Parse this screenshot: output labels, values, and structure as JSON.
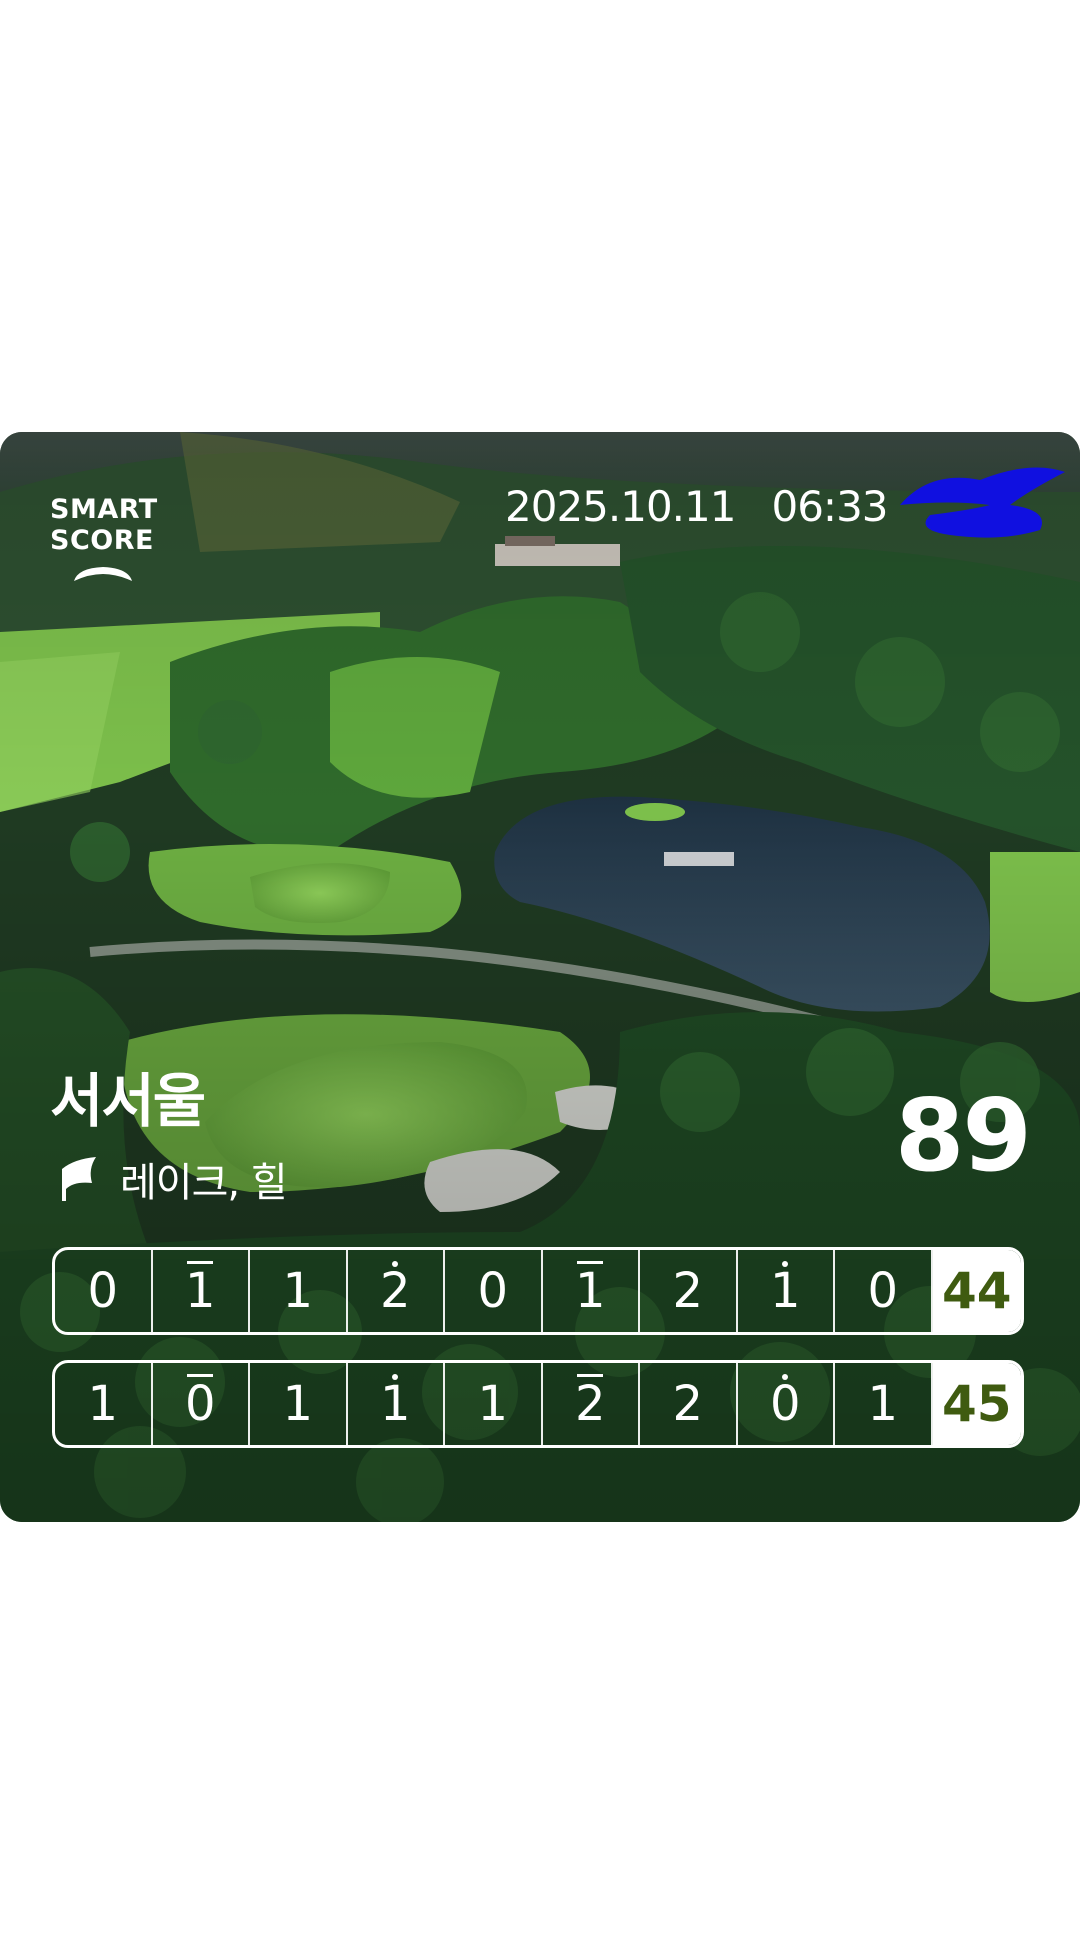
{
  "header": {
    "logo_line1": "SMART",
    "logo_line2": "SCORE",
    "date": "2025.10.11",
    "time": "06:33"
  },
  "course": {
    "name": "서서울",
    "sub_course": "레이크, 힐"
  },
  "total_score": "89",
  "front_nine": {
    "holes": [
      {
        "score": "0",
        "mark": ""
      },
      {
        "score": "1",
        "mark": "bar"
      },
      {
        "score": "1",
        "mark": ""
      },
      {
        "score": "2",
        "mark": "dot"
      },
      {
        "score": "0",
        "mark": ""
      },
      {
        "score": "1",
        "mark": "bar"
      },
      {
        "score": "2",
        "mark": ""
      },
      {
        "score": "1",
        "mark": "dot"
      },
      {
        "score": "0",
        "mark": ""
      }
    ],
    "subtotal": "44"
  },
  "back_nine": {
    "holes": [
      {
        "score": "1",
        "mark": ""
      },
      {
        "score": "0",
        "mark": "bar"
      },
      {
        "score": "1",
        "mark": ""
      },
      {
        "score": "1",
        "mark": "dot"
      },
      {
        "score": "1",
        "mark": ""
      },
      {
        "score": "2",
        "mark": "bar"
      },
      {
        "score": "2",
        "mark": ""
      },
      {
        "score": "0",
        "mark": "dot"
      },
      {
        "score": "1",
        "mark": ""
      }
    ],
    "subtotal": "45"
  },
  "colors": {
    "subtotal_text": "#3f5b10",
    "redaction": "#1010e0"
  }
}
